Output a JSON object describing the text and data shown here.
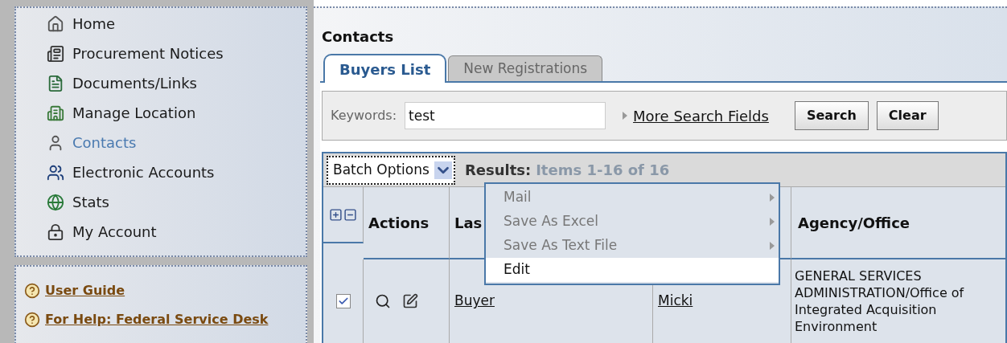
{
  "sidebar": {
    "nav": [
      {
        "label": "Home",
        "selected": false
      },
      {
        "label": "Procurement Notices",
        "selected": false
      },
      {
        "label": "Documents/Links",
        "selected": false
      },
      {
        "label": "Manage Location",
        "selected": false
      },
      {
        "label": "Contacts",
        "selected": true
      },
      {
        "label": "Electronic Accounts",
        "selected": false
      },
      {
        "label": "Stats",
        "selected": false
      },
      {
        "label": "My Account",
        "selected": false
      }
    ],
    "help_links": [
      "User Guide",
      "For Help: Federal Service Desk"
    ]
  },
  "main": {
    "title": "Contacts",
    "tabs": [
      {
        "label": "Buyers List",
        "selected": true
      },
      {
        "label": "New Registrations",
        "selected": false
      }
    ],
    "search": {
      "label": "Keywords:",
      "value": "test",
      "more_link": "More Search Fields",
      "buttons": [
        "Search",
        "Clear"
      ]
    },
    "batch": {
      "label": "Batch Options",
      "expanded": true,
      "results_label": "Results:",
      "results_text": "Items 1-16 of 16"
    },
    "menu": [
      {
        "label": "Mail",
        "disabled": true,
        "submenu": true,
        "highlighted": false
      },
      {
        "label": "Save As Excel",
        "disabled": true,
        "submenu": true,
        "highlighted": false
      },
      {
        "label": "Save As Text File",
        "disabled": true,
        "submenu": true,
        "highlighted": false
      },
      {
        "label": "Edit",
        "disabled": false,
        "submenu": false,
        "highlighted": true
      }
    ],
    "table": {
      "columns": [
        "Actions",
        "Las",
        "Agency/Office"
      ],
      "rows": [
        {
          "checked": true,
          "last_name": "Buyer",
          "first_name": "Micki",
          "agency": "GENERAL SERVICES ADMINISTRATION/Office of Integrated Acquisition Environment"
        }
      ]
    }
  }
}
